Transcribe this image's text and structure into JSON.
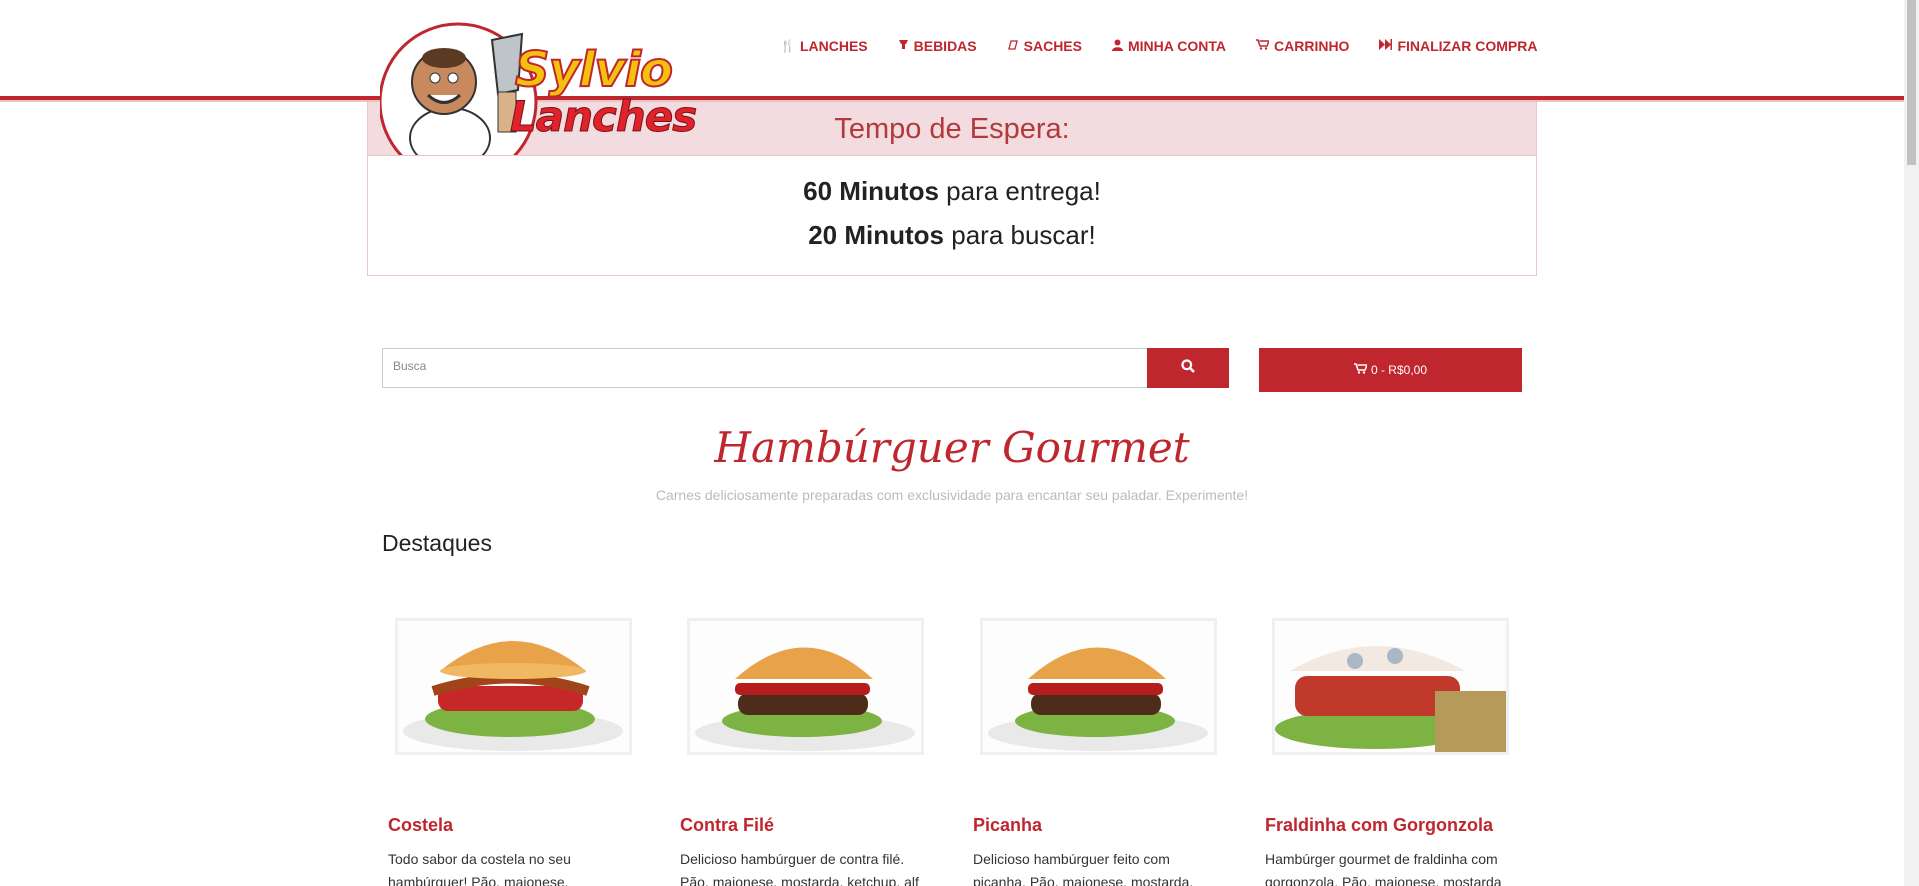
{
  "brand": {
    "name_line1": "Sylvio",
    "name_line2": "Lanches"
  },
  "nav": [
    {
      "icon": "utensils-icon",
      "label": "LANCHES"
    },
    {
      "icon": "glass-icon",
      "label": "BEBIDAS"
    },
    {
      "icon": "sachet-icon",
      "label": "SACHES"
    },
    {
      "icon": "user-icon",
      "label": "MINHA CONTA"
    },
    {
      "icon": "cart-icon",
      "label": "CARRINHO"
    },
    {
      "icon": "fast-forward-icon",
      "label": "FINALIZAR COMPRA"
    }
  ],
  "wait": {
    "title": "Tempo de Espera:",
    "delivery_time": "60 Minutos",
    "delivery_text": "para entrega!",
    "pickup_time": "20 Minutos",
    "pickup_text": "para buscar!"
  },
  "search": {
    "placeholder": "Busca"
  },
  "cart": {
    "label": "0 - R$0,00"
  },
  "section": {
    "title": "Hambúrguer Gourmet",
    "subtitle": "Carnes deliciosamente preparadas com exclusividade para encantar seu paladar. Experimente!",
    "highlights": "Destaques"
  },
  "products": [
    {
      "name": "Costela",
      "desc": "Todo sabor da costela no seu hambúrguer! Pão, maionese, mostarda,"
    },
    {
      "name": "Contra Filé",
      "desc": "Delicioso hambúrguer de contra filé. Pão, maionese, mostarda, ketchup, alf"
    },
    {
      "name": "Picanha",
      "desc": "Delicioso hambúrguer feito com picanha. Pão, maionese, mostarda,"
    },
    {
      "name": "Fraldinha com Gorgonzola",
      "desc": "Hambúrger gourmet de fraldinha com gorgonzola. Pão, maionese, mostarda"
    }
  ],
  "colors": {
    "brand_red": "#c0262d",
    "panel_pink": "#f2dcdf"
  }
}
